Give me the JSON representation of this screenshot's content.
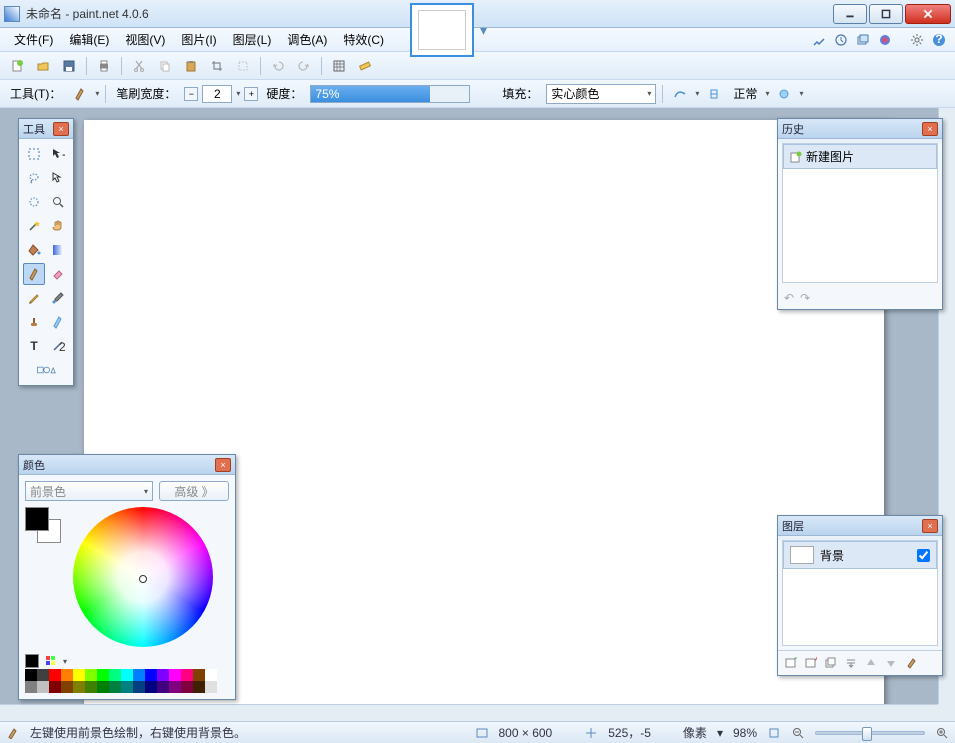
{
  "window": {
    "title": "未命名 - paint.net 4.0.6"
  },
  "menu": {
    "file": "文件(F)",
    "edit": "编辑(E)",
    "view": "视图(V)",
    "image": "图片(I)",
    "layers": "图层(L)",
    "adjust": "调色(A)",
    "effects": "特效(C)"
  },
  "opt": {
    "tool_label": "工具(T)：",
    "brush_width_label": "笔刷宽度：",
    "brush_width_value": "2",
    "hardness_label": "硬度：",
    "hardness_value": "75%",
    "fill_label": "填充：",
    "fill_value": "实心颜色",
    "blend_label": "正常"
  },
  "toolsPanel": {
    "title": "工具"
  },
  "historyPanel": {
    "title": "历史",
    "item0": "新建图片"
  },
  "layersPanel": {
    "title": "图层",
    "bg": "背景"
  },
  "colorsPanel": {
    "title": "颜色",
    "mode": "前景色",
    "advanced": "高级 》"
  },
  "status": {
    "hint": "左键使用前景色绘制，右键使用背景色。",
    "size": "800 × 600",
    "pos": "525，-5",
    "unit": "像素",
    "zoom": "98%"
  },
  "palette": [
    "#000",
    "#404040",
    "#ff0000",
    "#ff8000",
    "#ffff00",
    "#80ff00",
    "#00ff00",
    "#00ff80",
    "#00ffff",
    "#0080ff",
    "#0000ff",
    "#8000ff",
    "#ff00ff",
    "#ff0080",
    "#804000",
    "#fff",
    "#808080",
    "#c0c0c0",
    "#800000",
    "#804000",
    "#808000",
    "#408000",
    "#008000",
    "#008040",
    "#008080",
    "#004080",
    "#000080",
    "#400080",
    "#800080",
    "#800040",
    "#402000",
    "#e0e0e0"
  ]
}
